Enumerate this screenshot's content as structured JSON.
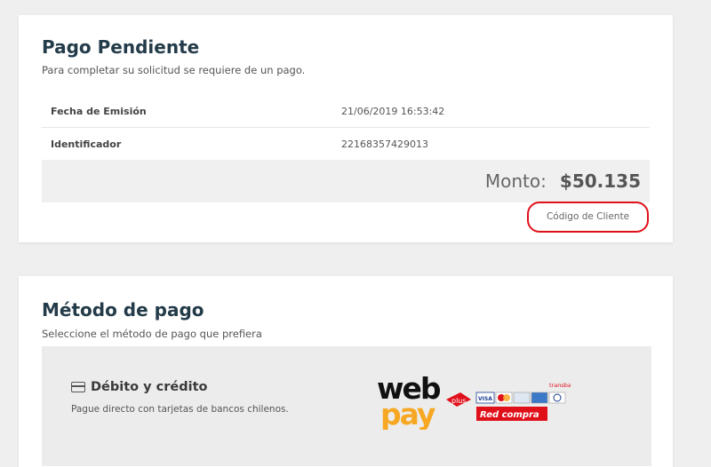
{
  "pending": {
    "title": "Pago Pendiente",
    "subtitle": "Para completar su solicitud se requiere de un pago.",
    "rows": [
      {
        "label": "Fecha de Emisión",
        "value": "21/06/2019 16:53:42"
      },
      {
        "label": "Identificador",
        "value": "22168357429013"
      }
    ],
    "amount_label": "Monto:",
    "amount_value": "$50.135",
    "client_code_label": "Código de Cliente"
  },
  "method": {
    "title": "Método de pago",
    "subtitle": "Seleccione el método de pago que prefiera",
    "option": {
      "title": "Débito y crédito",
      "description": "Pague directo con tarjetas de bancos chilenos.",
      "icon": "credit-card-icon"
    },
    "logo": {
      "web": "web",
      "pay": "pay",
      "plus": "plus",
      "transbank": "transbank.",
      "redcompra": "Red compra",
      "cards": [
        "VISA",
        "MasterCard",
        "Magna",
        "AMEX",
        "Diners"
      ]
    }
  },
  "colors": {
    "accent_red": "#e0101a",
    "title_dark": "#243b4a",
    "webpay_orange": "#f7a823"
  }
}
